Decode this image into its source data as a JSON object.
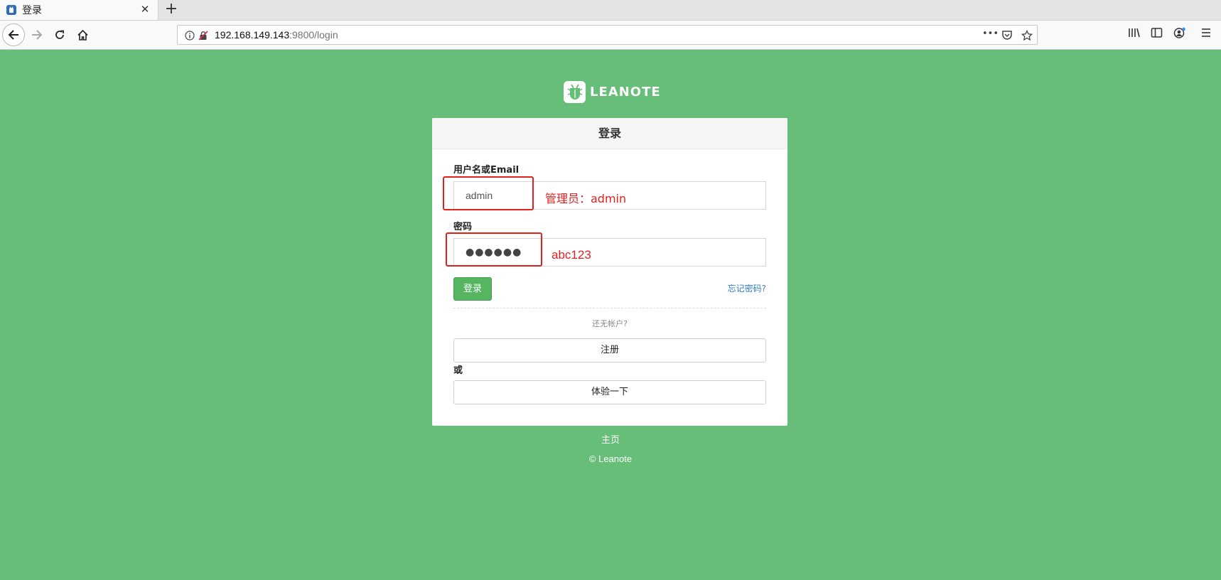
{
  "browser": {
    "tab_title": "登录",
    "tab_close": "✕",
    "new_tab": "+",
    "url_host": "192.168.149.143",
    "url_path": ":9800/login",
    "url_more": "•••"
  },
  "logo": {
    "text": "LEANOTE"
  },
  "login_card": {
    "header": "登录",
    "username_label": "用户名或Email",
    "username_value": "admin",
    "password_label": "密码",
    "password_value": "●●●●●●",
    "login_button": "登录",
    "forgot_link": "忘记密码?",
    "no_account": "还无帐户?",
    "register_button": "注册",
    "or_text": "或",
    "try_button": "体验一下"
  },
  "footer": {
    "home_link": "主页",
    "copyright": "© Leanote"
  },
  "annotations": {
    "admin_note": "管理员：admin",
    "password_note": "abc123",
    "color": "#e4201f"
  },
  "colors": {
    "page_background": "#66be78",
    "login_button": "#55b560",
    "link": "#2f7cc1"
  }
}
